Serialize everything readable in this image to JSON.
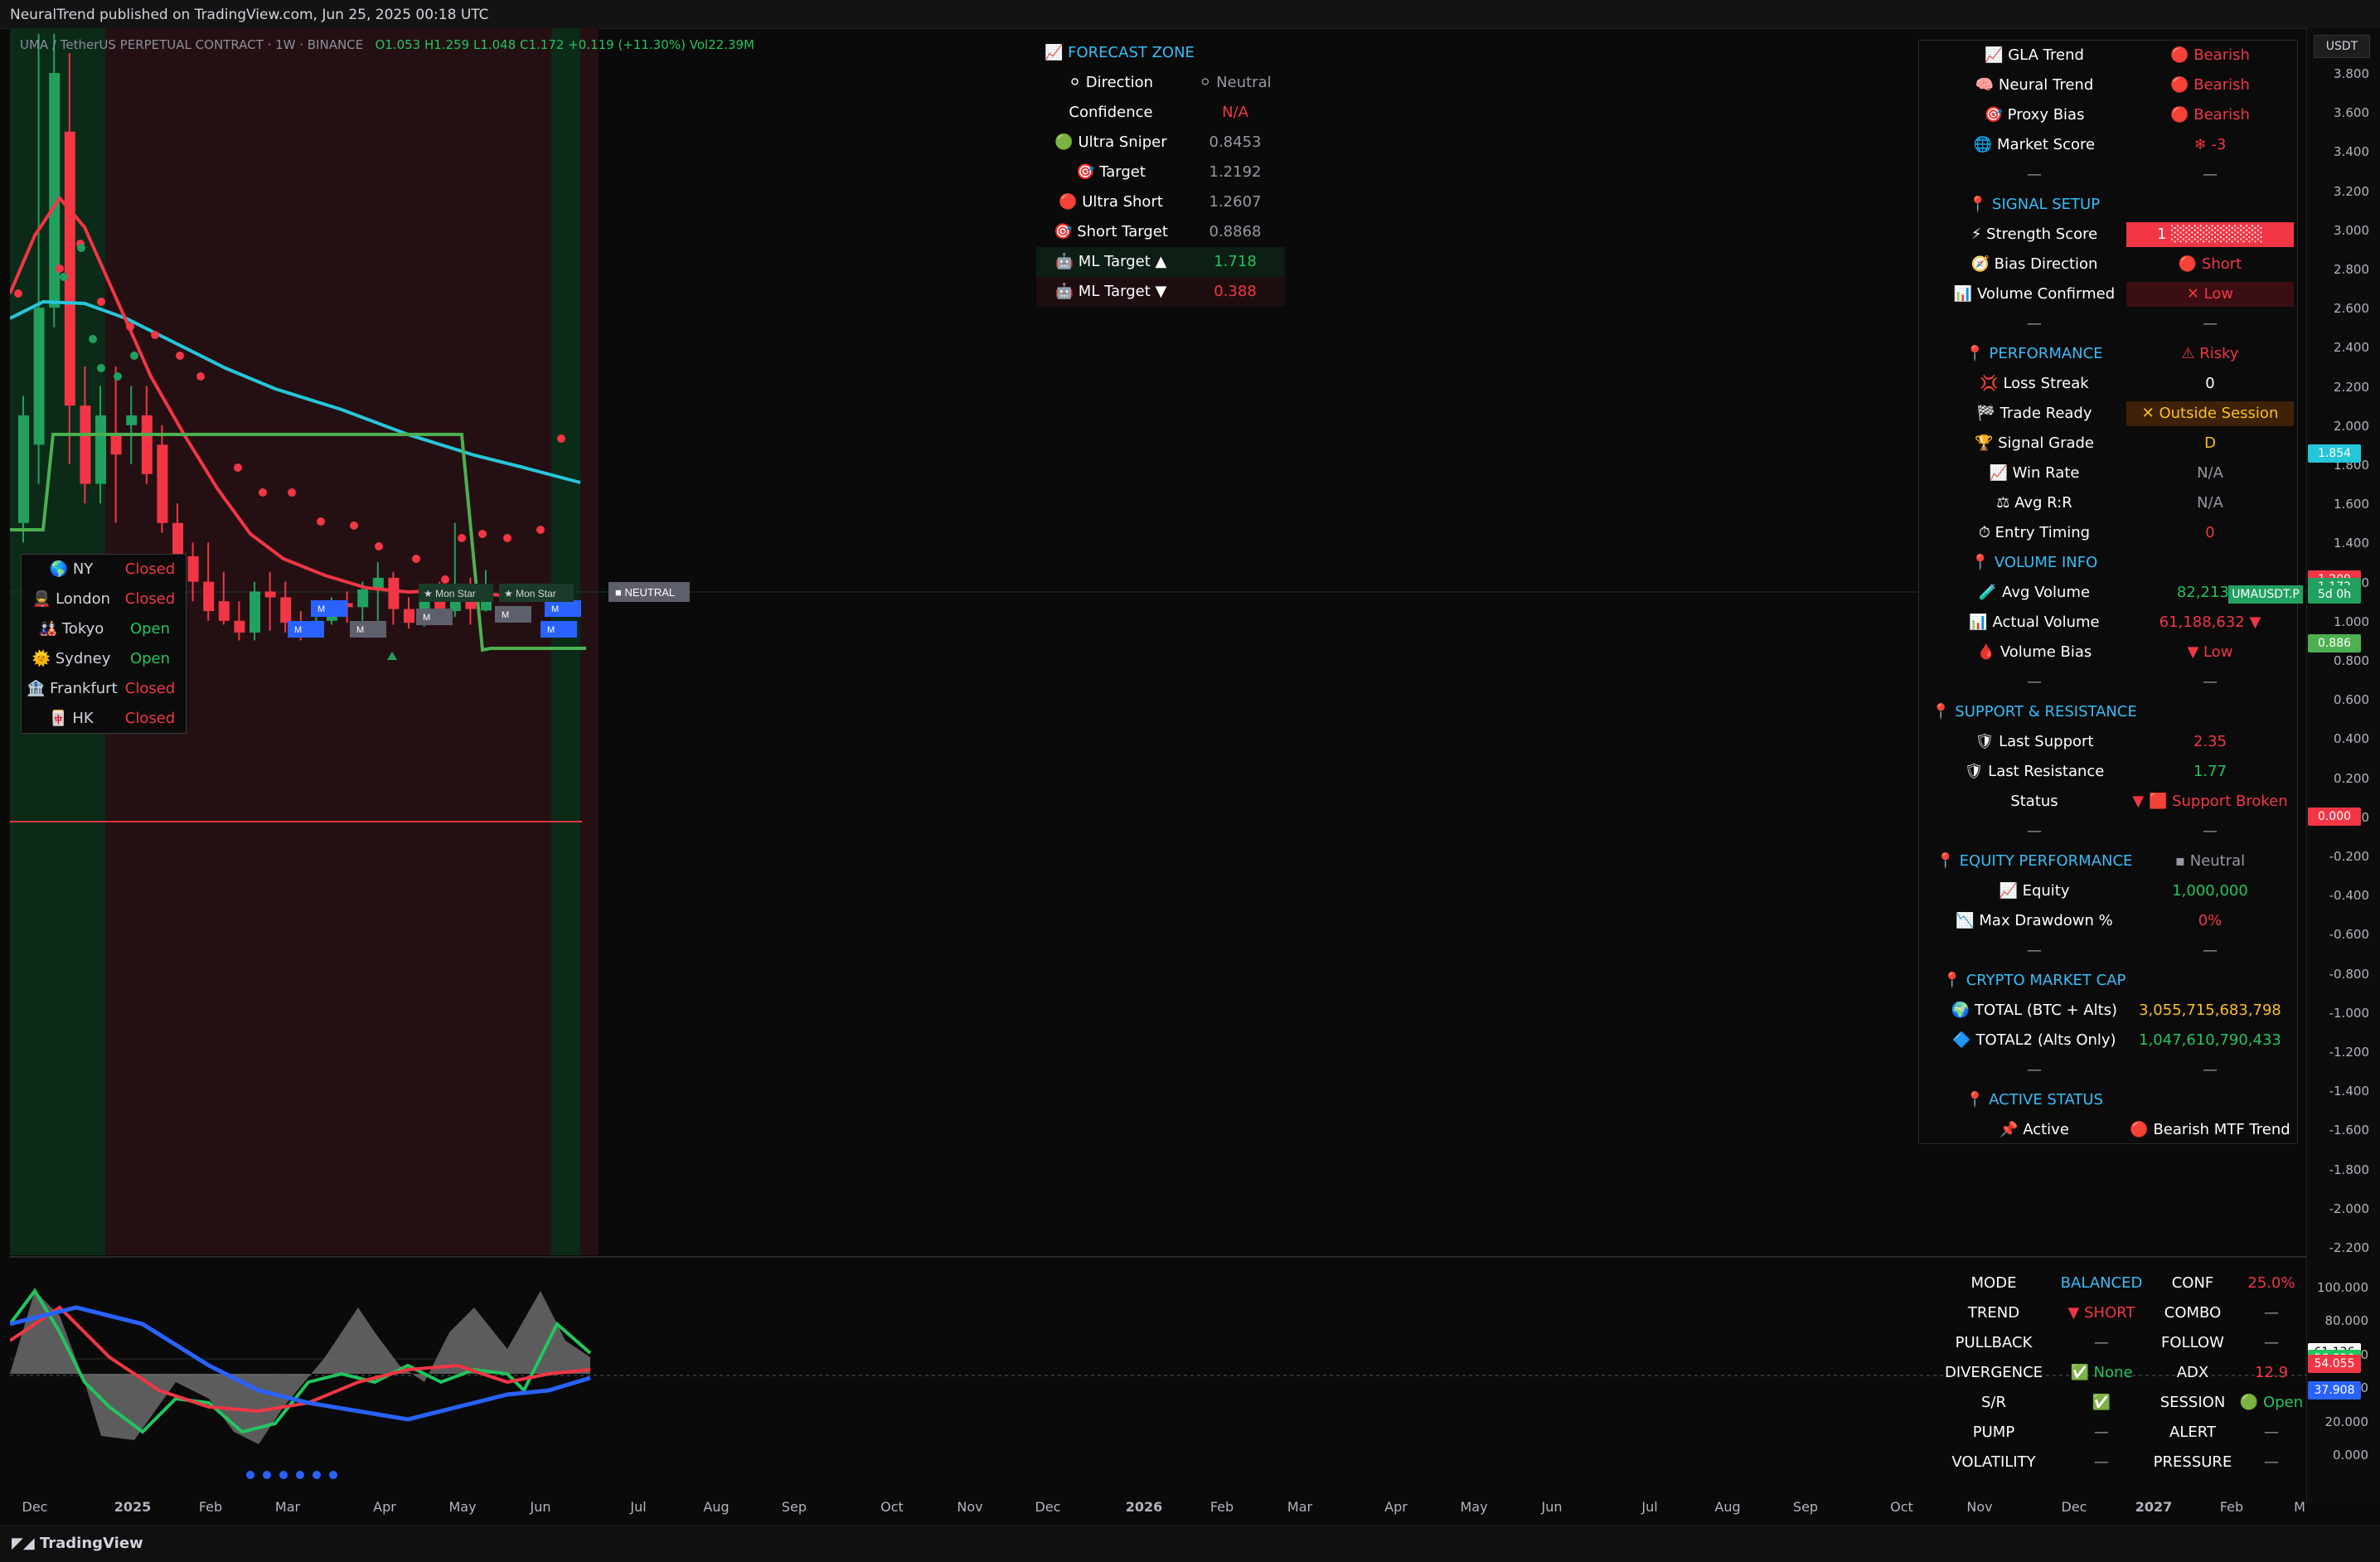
{
  "header": {
    "published_text": "NeuralTrend published on TradingView.com, Jun 25, 2025 00:18 UTC"
  },
  "symbol": {
    "name": "UMA / TetherUS PERPETUAL CONTRACT · 1W · BINANCE",
    "ohlc": "O1.053  H1.259  L1.048  C1.172  +0.119 (+11.30%)  Vol22.39M"
  },
  "colors": {
    "bull": "#22c55e",
    "bear": "#f23645",
    "accent": "#38bdf8",
    "ema_fast": "#f23645",
    "ema_slow": "#26c6da",
    "channel": "#4caf50"
  },
  "price_axis": {
    "currency": "USDT",
    "ticks": [
      "3.800",
      "3.600",
      "3.400",
      "3.200",
      "3.000",
      "2.800",
      "2.600",
      "2.400",
      "2.200",
      "2.000",
      "1.800",
      "1.600",
      "1.400",
      "1.200",
      "1.000",
      "0.800",
      "0.600",
      "0.400",
      "0.200",
      "0.000",
      "-0.200",
      "-0.400",
      "-0.600",
      "-0.800",
      "-1.000",
      "-1.200",
      "-1.400",
      "-1.600",
      "-1.800",
      "-2.000",
      "-2.200"
    ],
    "tags": [
      {
        "text": "1.854",
        "color": "#26c6da"
      },
      {
        "text": "1.209",
        "color": "#f23645"
      },
      {
        "text": "1.172",
        "color": "#22a060"
      },
      {
        "text": "5d 0h",
        "color": "#22a060"
      },
      {
        "text": "0.886",
        "color": "#4caf50"
      },
      {
        "text": "0.000",
        "color": "#f23645"
      }
    ],
    "ticker_tag": "UMAUSDT.P"
  },
  "oscillator_axis": {
    "ticks": [
      "100.000",
      "80.000",
      "60.000",
      "40.000",
      "20.000",
      "0.000"
    ],
    "tags": [
      {
        "text": "61.136",
        "color": "#ffffff"
      },
      {
        "text": "56.820",
        "color": "#22c55e"
      },
      {
        "text": "54.055",
        "color": "#f23645"
      },
      {
        "text": "37.908",
        "color": "#2962ff"
      }
    ]
  },
  "time_axis": [
    "Dec",
    "2025",
    "Feb",
    "Mar",
    "Apr",
    "May",
    "Jun",
    "Jul",
    "Aug",
    "Sep",
    "Oct",
    "Nov",
    "Dec",
    "2026",
    "Feb",
    "Mar",
    "Apr",
    "May",
    "Jun",
    "Jul",
    "Aug",
    "Sep",
    "Oct",
    "Nov",
    "Dec",
    "2027",
    "Feb",
    "M"
  ],
  "neutral_label": "■ NEUTRAL",
  "sessions": [
    {
      "icon": "🌎",
      "name": "NY",
      "status": "Closed",
      "open": false
    },
    {
      "icon": "💂",
      "name": "London",
      "status": "Closed",
      "open": false
    },
    {
      "icon": "🎎",
      "name": "Tokyo",
      "status": "Open",
      "open": true
    },
    {
      "icon": "🌞",
      "name": "Sydney",
      "status": "Open",
      "open": true
    },
    {
      "icon": "🏦",
      "name": "Frankfurt",
      "status": "Closed",
      "open": false
    },
    {
      "icon": "🀄",
      "name": "HK",
      "status": "Closed",
      "open": false
    }
  ],
  "forecast": {
    "title": "FORECAST ZONE",
    "rows": [
      {
        "label": "Direction",
        "value": "Neutral",
        "color": "grey",
        "icon": "⚪"
      },
      {
        "label": "Confidence",
        "value": "N/A",
        "color": "red"
      },
      {
        "label": "Ultra Sniper",
        "value": "0.8453",
        "color": "grey",
        "icon": "🟢"
      },
      {
        "label": "Target",
        "value": "1.2192",
        "color": "grey",
        "icon": "🎯"
      },
      {
        "label": "Ultra Short",
        "value": "1.2607",
        "color": "grey",
        "icon": "🔴"
      },
      {
        "label": "Short Target",
        "value": "0.8868",
        "color": "grey",
        "icon": "🎯"
      },
      {
        "label": "ML Target ▲",
        "value": "1.718",
        "color": "green",
        "icon": "🤖"
      },
      {
        "label": "ML Target ▼",
        "value": "0.388",
        "color": "red",
        "icon": "🤖"
      }
    ]
  },
  "signal_panel": {
    "rows": [
      {
        "label": "GLA Trend",
        "icon": "📈",
        "value": "Bearish",
        "vicon": "🔴",
        "color": "red"
      },
      {
        "label": "Neural Trend",
        "icon": "🧠",
        "value": "Bearish",
        "vicon": "🔴",
        "color": "red"
      },
      {
        "label": "Proxy Bias",
        "icon": "🎯",
        "value": "Bearish",
        "vicon": "🔴",
        "color": "red"
      },
      {
        "label": "Market Score",
        "icon": "🌐",
        "value": "-3",
        "vicon": "❄",
        "color": "red"
      },
      {
        "label": "—",
        "value": "—",
        "color": "grey",
        "sep": true
      },
      {
        "label": "SIGNAL SETUP",
        "icon": "📍",
        "header": true
      },
      {
        "label": "Strength Score",
        "icon": "⚡",
        "value": "1 ░░░░░░░░",
        "color": "white",
        "bg": "#f23645"
      },
      {
        "label": "Bias Direction",
        "icon": "🧭",
        "value": "Short",
        "vicon": "🔴",
        "color": "red"
      },
      {
        "label": "Volume Confirmed",
        "icon": "📊",
        "value": "✕ Low",
        "color": "red",
        "bg": "#3a0e12"
      },
      {
        "label": "—",
        "value": "—",
        "color": "grey",
        "sep": true
      },
      {
        "label": "PERFORMANCE",
        "icon": "📍",
        "header": true,
        "value": "⚠ Risky",
        "color": "red"
      },
      {
        "label": "Loss Streak",
        "icon": "💢",
        "value": "0",
        "color": "white"
      },
      {
        "label": "Trade Ready",
        "icon": "🏁",
        "value": "✕ Outside Session",
        "color": "orange",
        "bg": "#3d2208"
      },
      {
        "label": "Signal Grade",
        "icon": "🏆",
        "value": "D",
        "color": "orange"
      },
      {
        "label": "Win Rate",
        "icon": "📈",
        "value": "N/A",
        "color": "grey"
      },
      {
        "label": "Avg R:R",
        "icon": "⚖",
        "value": "N/A",
        "color": "grey"
      },
      {
        "label": "Entry Timing",
        "icon": "⏱",
        "value": "0",
        "color": "red"
      },
      {
        "label": "VOLUME INFO",
        "icon": "📍",
        "header": true
      },
      {
        "label": "Avg Volume",
        "icon": "🧪",
        "value": "82,213,1",
        "color": "green"
      },
      {
        "label": "Actual Volume",
        "icon": "📊",
        "value": "61,188,632 ▼",
        "color": "red"
      },
      {
        "label": "Volume Bias",
        "icon": "🩸",
        "value": "▼ Low",
        "color": "red"
      },
      {
        "label": "—",
        "value": "—",
        "color": "grey",
        "sep": true
      },
      {
        "label": "SUPPORT & RESISTANCE",
        "icon": "📍",
        "header": true
      },
      {
        "label": "Last Support",
        "icon": "🛡",
        "value": "2.35",
        "color": "red"
      },
      {
        "label": "Last Resistance",
        "icon": "🛡",
        "value": "1.77",
        "color": "green"
      },
      {
        "label": "Status",
        "value": "▼ 🟥 Support Broken",
        "color": "red"
      },
      {
        "label": "—",
        "value": "—",
        "color": "grey",
        "sep": true
      },
      {
        "label": "EQUITY PERFORMANCE",
        "icon": "📍",
        "header": true,
        "value": "▪ Neutral",
        "color": "grey"
      },
      {
        "label": "Equity",
        "icon": "📈",
        "value": "1,000,000",
        "color": "green"
      },
      {
        "label": "Max Drawdown %",
        "icon": "📉",
        "value": "0%",
        "color": "red"
      },
      {
        "label": "—",
        "value": "—",
        "color": "grey",
        "sep": true
      },
      {
        "label": "CRYPTO MARKET CAP",
        "icon": "📍",
        "header": true
      },
      {
        "label": "TOTAL (BTC + Alts)",
        "icon": "🌍",
        "value": "3,055,715,683,798",
        "color": "orange"
      },
      {
        "label": "TOTAL2 (Alts Only)",
        "icon": "🔷",
        "value": "1,047,610,790,433",
        "color": "green"
      },
      {
        "label": "—",
        "value": "—",
        "color": "grey",
        "sep": true
      },
      {
        "label": "ACTIVE STATUS",
        "icon": "📍",
        "header": true
      },
      {
        "label": "Active",
        "icon": "📌",
        "value": "Bearish MTF Trend",
        "vicon": "🔴",
        "color": "white"
      }
    ]
  },
  "bottom_table": [
    {
      "k1": "MODE",
      "v1": "BALANCED",
      "c1": "accent",
      "k2": "CONF",
      "v2": "25.0%",
      "c2": "red"
    },
    {
      "k1": "TREND",
      "v1": "▼ SHORT",
      "c1": "red",
      "k2": "COMBO",
      "v2": "—",
      "c2": "grey"
    },
    {
      "k1": "PULLBACK",
      "v1": "—",
      "c1": "grey",
      "k2": "FOLLOW",
      "v2": "—",
      "c2": "grey"
    },
    {
      "k1": "DIVERGENCE",
      "v1": "✅ None",
      "c1": "green",
      "k2": "ADX",
      "v2": "12.9",
      "c2": "red"
    },
    {
      "k1": "S/R",
      "v1": "✅",
      "c1": "green",
      "k2": "SESSION",
      "v2": "🟢 Open",
      "c2": "green"
    },
    {
      "k1": "PUMP",
      "v1": "—",
      "c1": "grey",
      "k2": "ALERT",
      "v2": "—",
      "c2": "grey"
    },
    {
      "k1": "VOLATILITY",
      "v1": "—",
      "c1": "grey",
      "k2": "PRESSURE",
      "v2": "—",
      "c2": "grey"
    }
  ],
  "chart_labels": {
    "mon_star": "Mon Star",
    "signal_tag": "M"
  },
  "footer": {
    "logo_text": "TradingView"
  }
}
